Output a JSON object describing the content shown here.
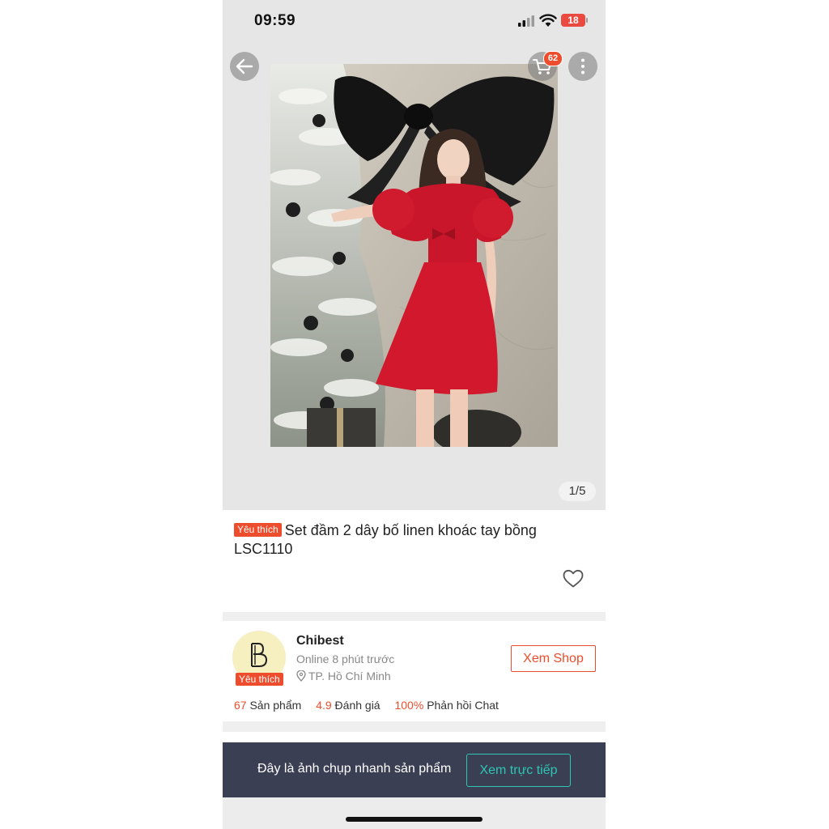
{
  "status_bar": {
    "time": "09:59",
    "battery": "18"
  },
  "header": {
    "cart_count": "62"
  },
  "gallery": {
    "page_counter": "1/5"
  },
  "product": {
    "favorite_tag": "Yêu thích",
    "title": "Set đầm 2 dây bố linen khoác tay bồng LSC1110"
  },
  "shop": {
    "name": "Chibest",
    "online_status": "Online 8 phút trước",
    "location": "TP. Hồ Chí Minh",
    "favorite_tag": "Yêu thích",
    "view_shop_label": "Xem Shop",
    "stats": [
      {
        "value": "67",
        "label": "Sản phẩm"
      },
      {
        "value": "4.9",
        "label": "Đánh giá"
      },
      {
        "value": "100%",
        "label": "Phản hồi Chat"
      }
    ]
  },
  "snapshot": {
    "message": "Đây là ảnh chụp nhanh sản phẩm",
    "live_label": "Xem trực tiếp"
  },
  "colors": {
    "accent": "#ee4d2d",
    "teal": "#2cc6b2",
    "snapshot_bg": "#3b3f54"
  }
}
